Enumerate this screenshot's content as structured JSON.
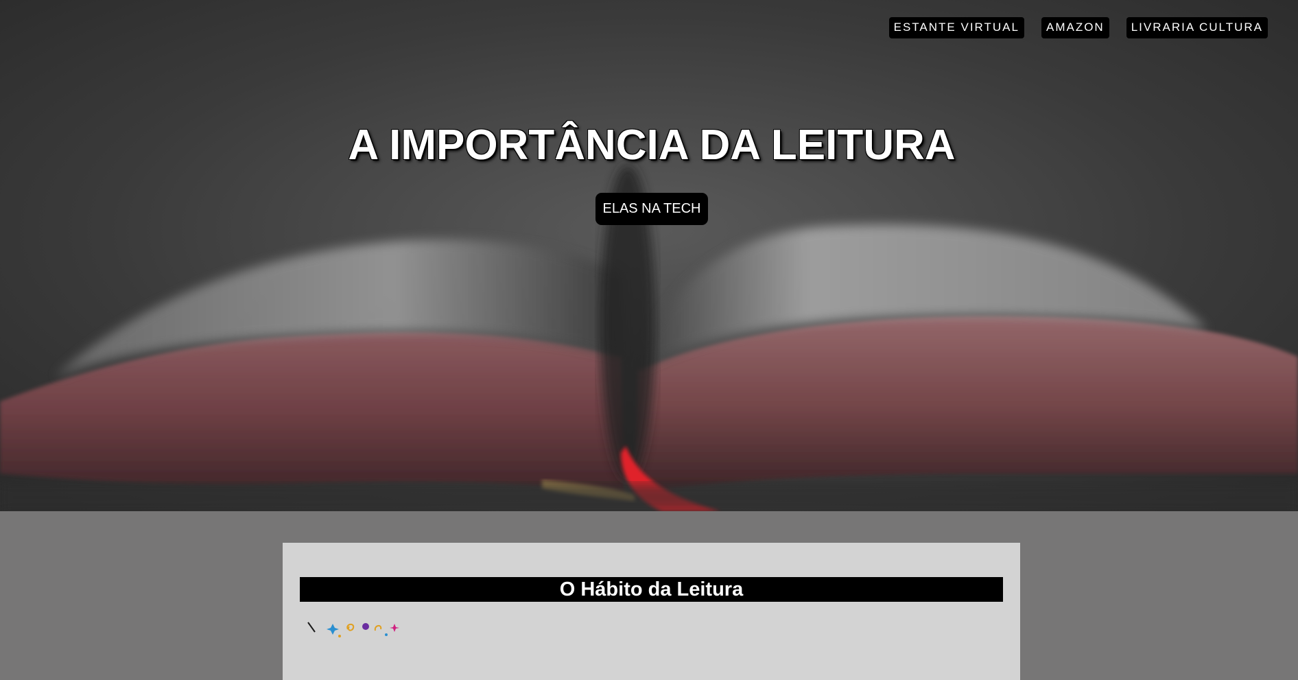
{
  "nav": {
    "links": [
      {
        "label": "ESTANTE VIRTUAL"
      },
      {
        "label": "AMAZON"
      },
      {
        "label": "LIVRARIA CULTURA"
      }
    ]
  },
  "hero": {
    "title": "A IMPORTÂNCIA DA LEITURA",
    "button_label": "ELAS NA TECH",
    "image": "open-book-photo"
  },
  "section": {
    "heading": "O Hábito da Leitura",
    "decoration": "colorful-sparkles-illustration"
  },
  "colors": {
    "page_background": "#777676",
    "card_background": "#d3d3d3",
    "heading_background": "#000000",
    "ribbon": "#e0202a"
  }
}
